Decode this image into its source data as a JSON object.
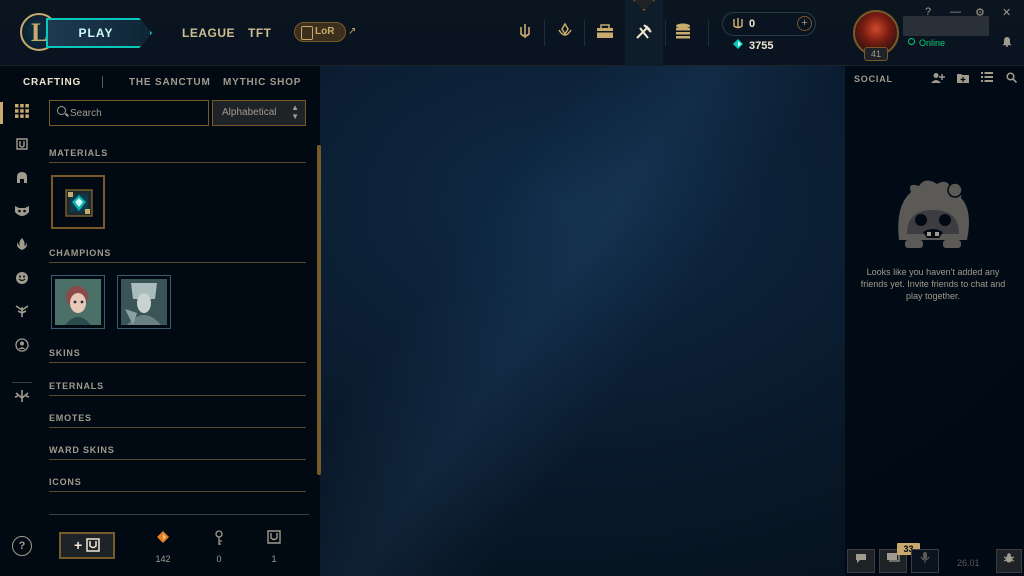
{
  "topbar": {
    "logo_letter": "L",
    "play_label": "PLAY",
    "nav": {
      "league": "LEAGUE",
      "tft": "TFT",
      "lor": "LoR",
      "lor_external": "↗"
    },
    "icons": [
      "clash-icon",
      "missions-icon",
      "store-icon",
      "crafting-icon",
      "collection-icon"
    ],
    "currency": {
      "rp": "0",
      "rp_add": "+",
      "blue_essence": "3755"
    },
    "profile": {
      "level": "41",
      "status": "Online"
    },
    "window_controls": {
      "help": "?",
      "minimize": "—",
      "settings": "⚙",
      "close": "✕",
      "bell": "🔔"
    }
  },
  "subnav": {
    "crafting": "CRAFTING",
    "sanctum": "THE SANCTUM",
    "mythic_shop": "MYTHIC SHOP"
  },
  "toolbar": {
    "search_placeholder": "Search",
    "sort_value": "Alphabetical"
  },
  "sections": {
    "materials": "MATERIALS",
    "champions": "CHAMPIONS",
    "skins": "SKINS",
    "eternals": "ETERNALS",
    "emotes": "EMOTES",
    "ward_skins": "WARD SKINS",
    "icons": "ICONS"
  },
  "footer": {
    "add_label": "+",
    "orange_essence": "142",
    "keys": "0",
    "chests": "1"
  },
  "social": {
    "title": "SOCIAL",
    "empty_message": "Looks like you haven't added any friends yet. Invite friends to chat and play together.",
    "badge_count": "33",
    "clock": "26.01"
  },
  "help_label": "?",
  "colors": {
    "gold": "#c8aa6e",
    "teal": "#0ac8b9",
    "online": "#0acb75",
    "background": "#010a13"
  }
}
